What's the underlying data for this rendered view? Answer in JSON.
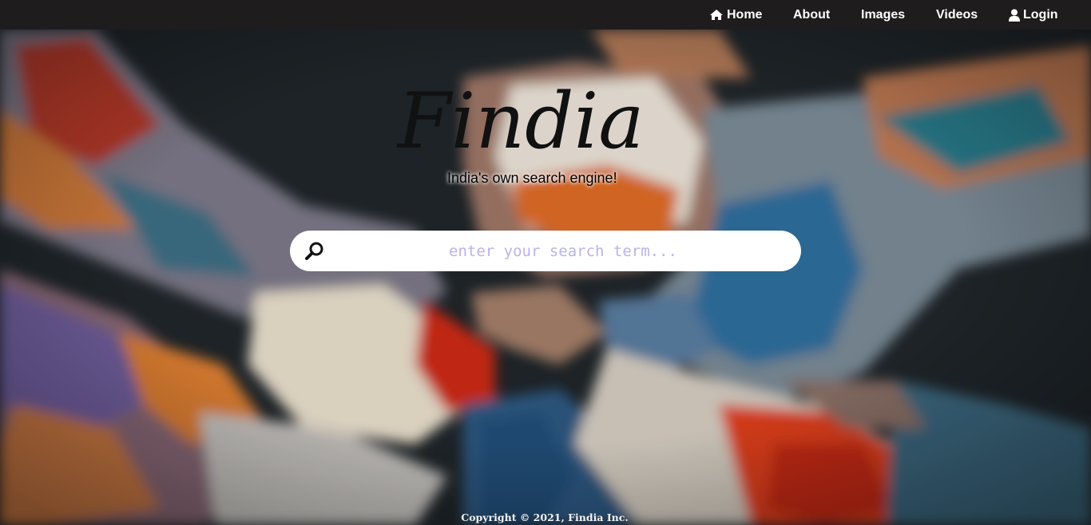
{
  "nav": {
    "home_label": "Home",
    "about_label": "About",
    "images_label": "Images",
    "videos_label": "Videos",
    "login_label": "Login"
  },
  "logo": {
    "text": "Findia"
  },
  "tagline": "India's own search engine!",
  "search": {
    "placeholder": "enter your search term...",
    "value": ""
  },
  "footer": {
    "copyright": "Copyright © 2021, Findia Inc."
  },
  "icons": {
    "home": "home-icon",
    "login": "user-icon",
    "search": "search-icon"
  }
}
